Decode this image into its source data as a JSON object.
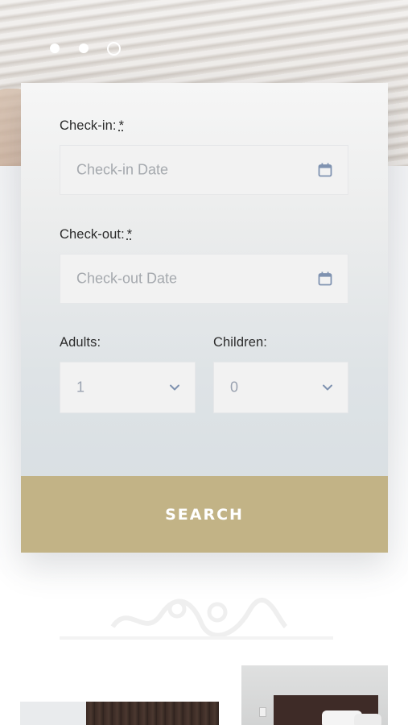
{
  "slider": {
    "dots": [
      "slide-1",
      "slide-2",
      "slide-3"
    ],
    "active_index": 3
  },
  "booking_form": {
    "checkin": {
      "label": "Check-in:",
      "required_mark": "*",
      "placeholder": "Check-in Date",
      "icon": "calendar-icon"
    },
    "checkout": {
      "label": "Check-out:",
      "required_mark": "*",
      "placeholder": "Check-out Date",
      "icon": "calendar-icon"
    },
    "adults": {
      "label": "Adults:",
      "value": "1",
      "icon": "chevron-down-icon"
    },
    "children": {
      "label": "Children:",
      "value": "0",
      "icon": "chevron-down-icon"
    },
    "search_label": "SEARCH"
  },
  "colors": {
    "accent": "#c2b386",
    "icon": "#7f92b0",
    "field_bg": "#f2f2f2",
    "label_text": "#2b2b2b",
    "placeholder_text": "#a5a9ae"
  }
}
